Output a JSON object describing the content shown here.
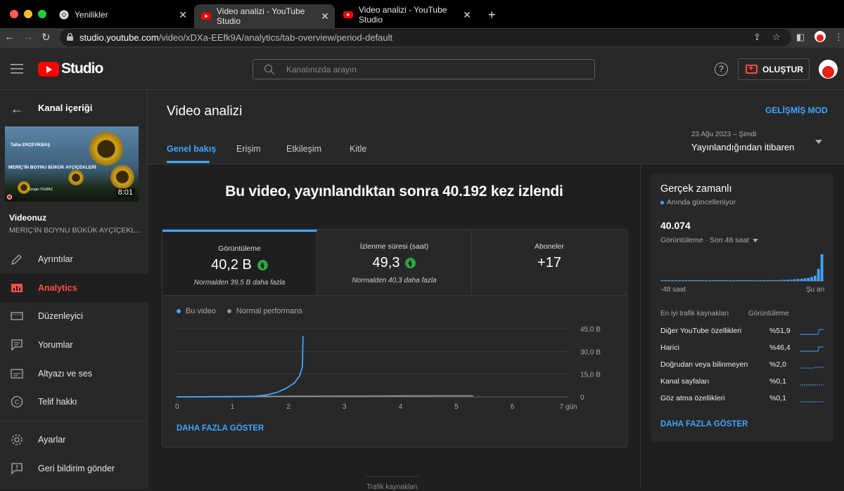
{
  "browser": {
    "tabs": [
      {
        "label": "Yenilikler"
      },
      {
        "label": "Video analizi - YouTube Studio"
      },
      {
        "label": "Video analizi - YouTube Studio"
      }
    ],
    "url_domain": "studio.youtube.com",
    "url_path": "/video/xDXa-EEfk9A/analytics/tab-overview/period-default"
  },
  "header": {
    "logo_text": "Studio",
    "search_placeholder": "Kanalınızda arayın",
    "help_label": "?",
    "create_label": "OLUŞTUR"
  },
  "sidebar": {
    "back_label": "Kanal içeriği",
    "thumbnail": {
      "line1": "Talha ERÇEVİKBAŞ",
      "line2": "MERİÇ'İN BOYNU BÜKÜK AYÇİÇEKLERİ",
      "line3": "Cengiz YILMAZ",
      "duration": "8:01"
    },
    "video_label": "Videonuz",
    "video_name": "MERİÇ'İN BOYNU BÜKÜK AYÇİÇEKL...",
    "items": [
      {
        "label": "Ayrıntılar",
        "icon": "pencil-icon"
      },
      {
        "label": "Analytics",
        "icon": "analytics-icon",
        "selected": true
      },
      {
        "label": "Düzenleyici",
        "icon": "film-icon"
      },
      {
        "label": "Yorumlar",
        "icon": "comment-icon"
      },
      {
        "label": "Altyazı ve ses",
        "icon": "subtitles-icon"
      },
      {
        "label": "Telif hakkı",
        "icon": "copyright-icon"
      }
    ],
    "footer_items": [
      {
        "label": "Ayarlar",
        "icon": "gear-icon"
      },
      {
        "label": "Geri bildirim gönder",
        "icon": "feedback-icon"
      }
    ]
  },
  "page": {
    "title": "Video analizi",
    "advanced_mode": "GELİŞMİŞ MOD",
    "tabs": [
      {
        "label": "Genel bakış",
        "active": true
      },
      {
        "label": "Erişim"
      },
      {
        "label": "Etkileşim"
      },
      {
        "label": "Kitle"
      }
    ],
    "date_range_sub": "23 Ağu 2023 – Şimdi",
    "date_range": "Yayınlandığından itibaren"
  },
  "overview": {
    "headline": "Bu video, yayınlandıktan sonra 40.192 kez izlendi",
    "metrics": [
      {
        "label": "Görüntüleme",
        "value": "40,2 B",
        "note": "Normalden 39,5 B daha fazla",
        "trend": "up"
      },
      {
        "label": "İzlenme süresi (saat)",
        "value": "49,3",
        "note": "Normalden 40,3 daha fazla",
        "trend": "up"
      },
      {
        "label": "Aboneler",
        "value": "+17",
        "note": ""
      }
    ],
    "show_more": "DAHA FAZLA GÖSTER",
    "bottom_hint": "Trafik kaynakları"
  },
  "chart_data": {
    "type": "line",
    "legend": [
      "Bu video",
      "Normal performans"
    ],
    "x_ticks": [
      "0",
      "1",
      "2",
      "3",
      "4",
      "5",
      "6",
      "7 gün"
    ],
    "y_ticks": [
      "45,0 B",
      "30,0 B",
      "15,0 B",
      "0"
    ],
    "ylim": [
      0,
      45000
    ],
    "series": [
      {
        "name": "Bu video",
        "color": "#3ea6ff",
        "x": [
          0,
          0.5,
          1,
          1.4,
          1.6,
          1.8,
          1.95,
          2.1,
          2.2,
          2.25,
          2.26
        ],
        "y": [
          0,
          50,
          120,
          350,
          1200,
          3000,
          5500,
          9000,
          14000,
          20000,
          40192
        ]
      },
      {
        "name": "Normal performans",
        "color": "#909090",
        "x": [
          0,
          1,
          2,
          3,
          4,
          5,
          5.3
        ],
        "y": [
          0,
          150,
          350,
          500,
          600,
          680,
          700
        ]
      }
    ]
  },
  "realtime": {
    "title": "Gerçek zamanlı",
    "sub": "Anında güncelleniyor",
    "value": "40.074",
    "period": "Görüntüleme · Son 48 saat",
    "axis_left": "-48 saat",
    "axis_right": "Şu an",
    "bars": [
      0.02,
      0.02,
      0.02,
      0.02,
      0.02,
      0.02,
      0.02,
      0.02,
      0.02,
      0.02,
      0.02,
      0.02,
      0.02,
      0.02,
      0.02,
      0.02,
      0.02,
      0.02,
      0.02,
      0.02,
      0.02,
      0.02,
      0.02,
      0.02,
      0.02,
      0.02,
      0.02,
      0.02,
      0.02,
      0.02,
      0.02,
      0.03,
      0.03,
      0.03,
      0.03,
      0.04,
      0.04,
      0.05,
      0.05,
      0.06,
      0.07,
      0.08,
      0.1,
      0.12,
      0.15,
      0.2,
      0.45,
      1.0
    ],
    "traffic_header_source": "En iyi trafik kaynakları",
    "traffic_header_views": "Görüntüleme",
    "traffic": [
      {
        "name": "Diğer YouTube özellikleri",
        "pct": "%51,9"
      },
      {
        "name": "Harici",
        "pct": "%46,4"
      },
      {
        "name": "Doğrudan veya bilinmeyen",
        "pct": "%2,0"
      },
      {
        "name": "Kanal sayfaları",
        "pct": "%0,1"
      },
      {
        "name": "Göz atma özellikleri",
        "pct": "%0,1"
      }
    ],
    "show_more": "DAHA FAZLA GÖSTER"
  }
}
